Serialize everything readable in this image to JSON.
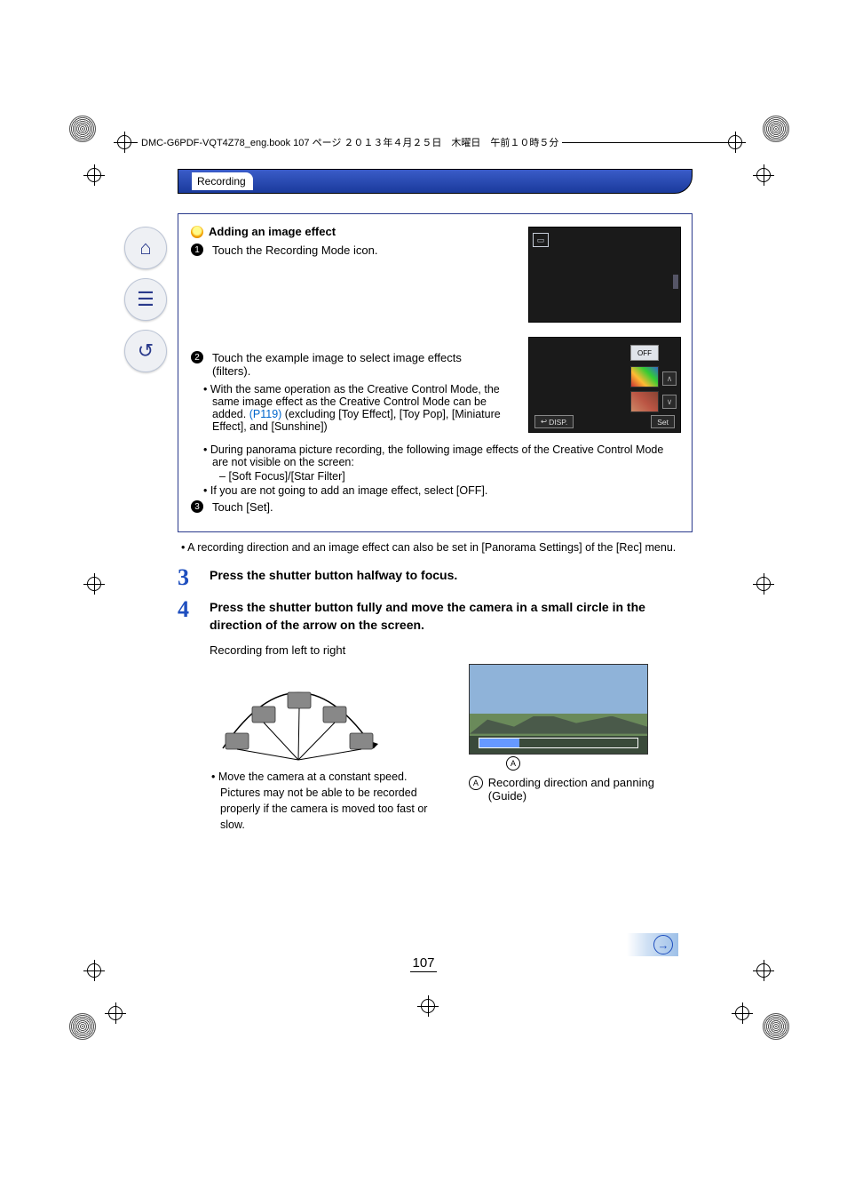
{
  "header": {
    "running_head": "DMC-G6PDF-VQT4Z78_eng.book  107 ページ  ２０１３年４月２５日　木曜日　午前１０時５分"
  },
  "section": {
    "title": "Recording"
  },
  "callout": {
    "title": "Adding an image effect",
    "steps": [
      {
        "num": "1",
        "text": "Touch the Recording Mode icon."
      },
      {
        "num": "2",
        "text": "Touch the example image to select image effects (filters)."
      },
      {
        "num": "3",
        "text": "Touch [Set]."
      }
    ],
    "sub2a_pre": "With the same operation as the Creative Control Mode, the same image effect as the Creative Control Mode can be added. ",
    "sub2a_link": "(P119)",
    "sub2a_post": " (excluding [Toy Effect], [Toy Pop], [Miniature Effect], and [Sunshine])",
    "sub2b": "During panorama picture recording, the following image effects of the Creative Control Mode are not visible on the screen:",
    "sub2b_dash": "[Soft Focus]/[Star Filter]",
    "sub2c": "If you are not going to add an image effect, select [OFF].",
    "note": "A recording direction and an image effect can also be set in [Panorama Settings] of the [Rec] menu.",
    "thumb2_off": "OFF",
    "thumb2_disp": "DISP.",
    "thumb2_set": "Set"
  },
  "steps": {
    "s3_num": "3",
    "s3_text": "Press the shutter button halfway to focus.",
    "s4_num": "4",
    "s4_text": "Press the shutter button fully and move the camera in a small circle in the direction of the arrow on the screen.",
    "subcap": "Recording from left to right",
    "left_note": "Move the camera at a constant speed. Pictures may not be able to be recorded properly if the camera is moved too fast or slow.",
    "A_mark": "A",
    "A_text": "Recording direction and panning (Guide)"
  },
  "page_number": "107"
}
